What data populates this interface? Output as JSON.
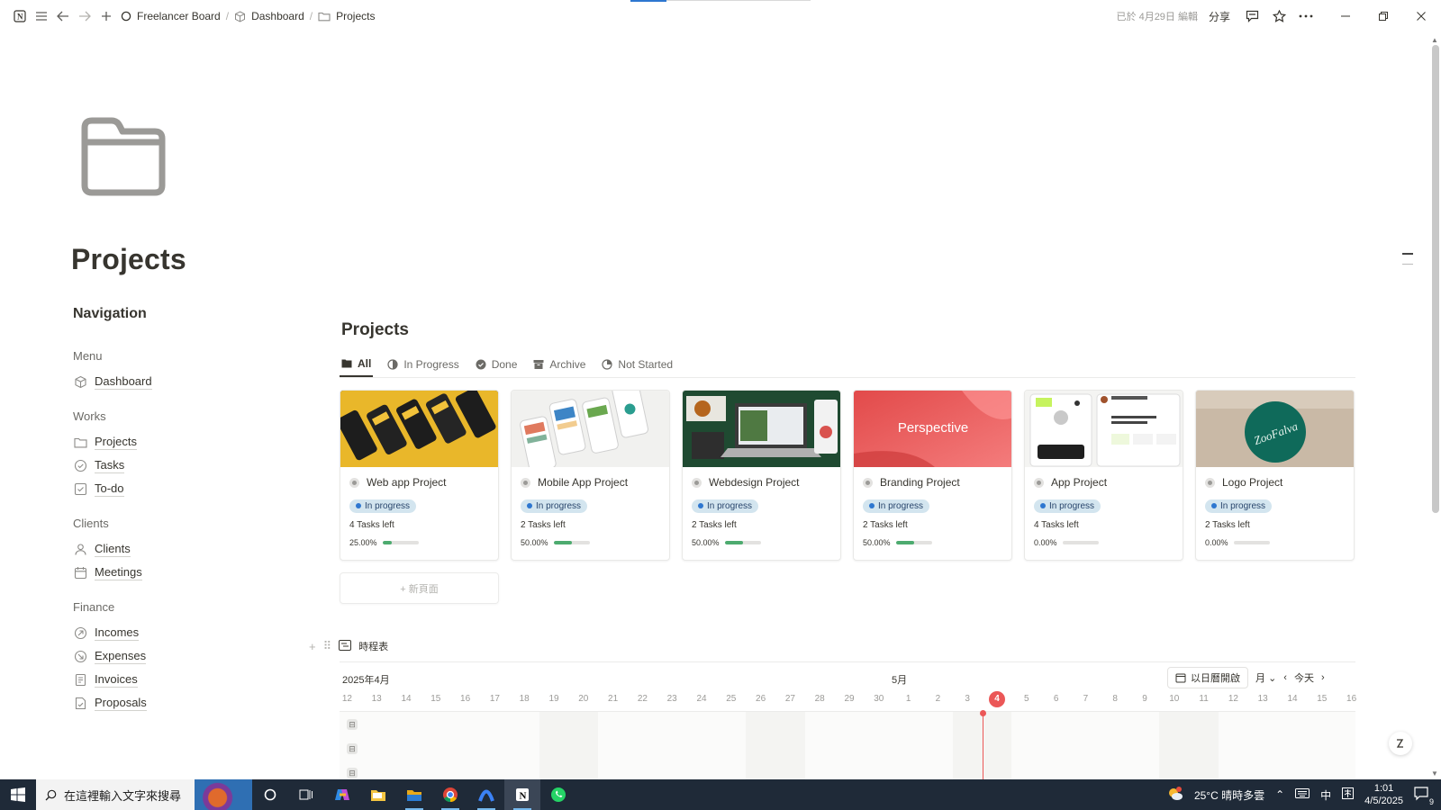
{
  "topbar": {
    "breadcrumbs": [
      {
        "label": "Freelancer Board",
        "icon": "circle-icon"
      },
      {
        "label": "Dashboard",
        "icon": "cube-icon"
      },
      {
        "label": "Projects",
        "icon": "folder-icon"
      }
    ],
    "edited_text": "已於 4月29日 編輯",
    "share_label": "分享"
  },
  "page": {
    "title": "Projects",
    "icon": "folder-icon"
  },
  "nav": {
    "heading": "Navigation",
    "groups": [
      {
        "title": "Menu",
        "items": [
          {
            "label": "Dashboard",
            "icon": "cube-icon"
          }
        ]
      },
      {
        "title": "Works",
        "items": [
          {
            "label": "Projects",
            "icon": "folder-icon"
          },
          {
            "label": "Tasks",
            "icon": "check-circle-icon"
          },
          {
            "label": "To-do",
            "icon": "checkbox-icon"
          }
        ]
      },
      {
        "title": "Clients",
        "items": [
          {
            "label": "Clients",
            "icon": "person-icon"
          },
          {
            "label": "Meetings",
            "icon": "calendar-icon"
          }
        ]
      },
      {
        "title": "Finance",
        "items": [
          {
            "label": "Incomes",
            "icon": "arrow-up-circle-icon"
          },
          {
            "label": "Expenses",
            "icon": "arrow-down-circle-icon"
          },
          {
            "label": "Invoices",
            "icon": "document-icon"
          },
          {
            "label": "Proposals",
            "icon": "document-check-icon"
          }
        ]
      }
    ]
  },
  "projects_view": {
    "title": "Projects",
    "tabs": [
      {
        "label": "All",
        "icon": "folder-icon",
        "active": true
      },
      {
        "label": "In Progress",
        "icon": "half-circle-icon",
        "active": false
      },
      {
        "label": "Done",
        "icon": "check-circle-icon",
        "active": false
      },
      {
        "label": "Archive",
        "icon": "archive-icon",
        "active": false
      },
      {
        "label": "Not Started",
        "icon": "pie-icon",
        "active": false
      }
    ],
    "cards": [
      {
        "name": "Web app Project",
        "status": "In progress",
        "tasks": "4 Tasks left",
        "progress_text": "25.00%",
        "progress": 0.25,
        "cover": "yellow-phones"
      },
      {
        "name": "Mobile App Project",
        "status": "In progress",
        "tasks": "2 Tasks left",
        "progress_text": "50.00%",
        "progress": 0.5,
        "cover": "white-phones"
      },
      {
        "name": "Webdesign Project",
        "status": "In progress",
        "tasks": "2 Tasks left",
        "progress_text": "50.00%",
        "progress": 0.5,
        "cover": "green-laptop"
      },
      {
        "name": "Branding Project",
        "status": "In progress",
        "tasks": "2 Tasks left",
        "progress_text": "50.00%",
        "progress": 0.5,
        "cover": "red-perspective"
      },
      {
        "name": "App Project",
        "status": "In progress",
        "tasks": "4 Tasks left",
        "progress_text": "0.00%",
        "progress": 0,
        "cover": "app-ui"
      },
      {
        "name": "Logo Project",
        "status": "In progress",
        "tasks": "2 Tasks left",
        "progress_text": "0.00%",
        "progress": 0,
        "cover": "zoofalva"
      }
    ],
    "cover_text": {
      "perspective": "Perspective",
      "zoofalva": "ZooFalva"
    },
    "new_page_label": "+ 新頁面"
  },
  "timeline": {
    "label": "時程表",
    "month_left": "2025年4月",
    "month_center": "5月",
    "start_from_label": "以日曆開啟",
    "scale_label": "月",
    "today_label": "今天",
    "days": [
      "12",
      "13",
      "14",
      "15",
      "16",
      "17",
      "18",
      "19",
      "20",
      "21",
      "22",
      "23",
      "24",
      "25",
      "26",
      "27",
      "28",
      "29",
      "30",
      "1",
      "2",
      "3",
      "4",
      "5",
      "6",
      "7",
      "8",
      "9",
      "10",
      "11",
      "12",
      "13",
      "14",
      "15",
      "16"
    ],
    "today": "4"
  },
  "taskbar": {
    "search_placeholder": "在這裡輸入文字來搜尋",
    "weather": "25°C 晴時多雲",
    "ime": "中",
    "time": "1:01",
    "date": "4/5/2025",
    "notifications": "9"
  },
  "colors": {
    "accent": "#2e77d0",
    "progress": "#4dab6f",
    "today": "#eb5757",
    "badge_bg": "#d3e5ef"
  }
}
